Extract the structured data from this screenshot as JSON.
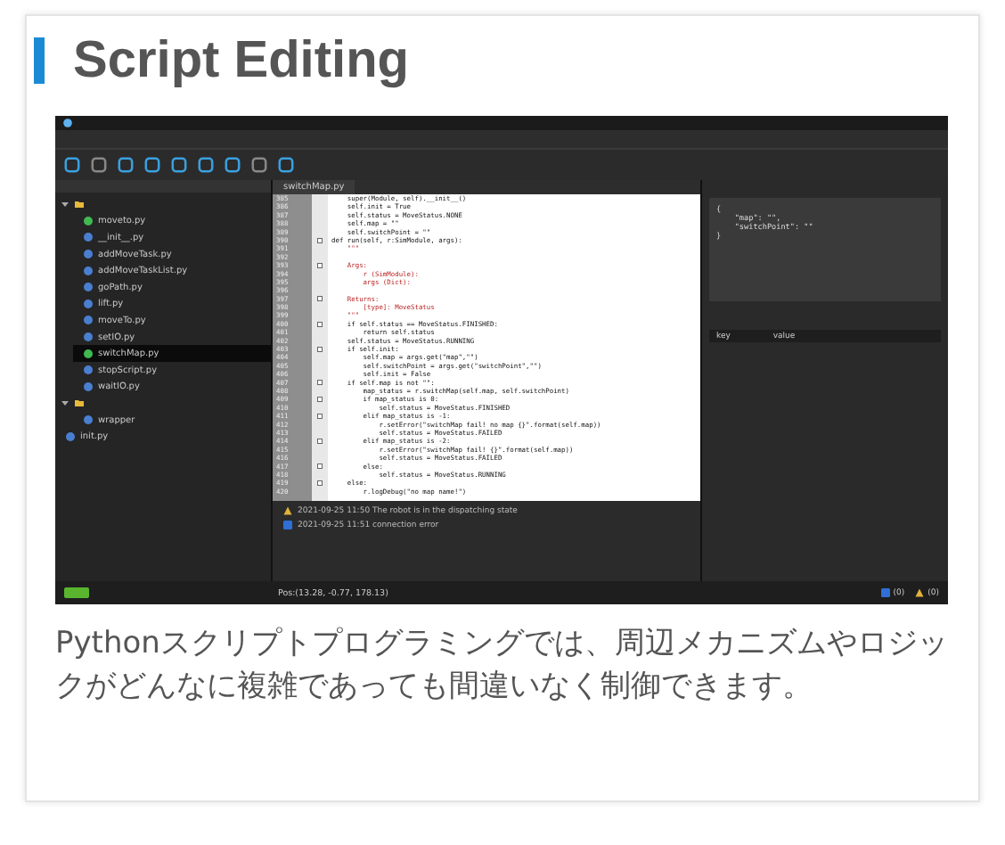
{
  "title": "Script Editing",
  "ide": {
    "sidebar": {
      "items": [
        {
          "kind": "folder",
          "children": [
            {
              "kind": "file",
              "label": "moveto.py",
              "selected": false,
              "color": "#3fb950"
            },
            {
              "kind": "file",
              "label": "__init__.py",
              "selected": false,
              "color": "#4a7fd0"
            },
            {
              "kind": "file",
              "label": "addMoveTask.py",
              "selected": false,
              "color": "#4a7fd0"
            },
            {
              "kind": "file",
              "label": "addMoveTaskList.py",
              "selected": false,
              "color": "#4a7fd0"
            },
            {
              "kind": "file",
              "label": "goPath.py",
              "selected": false,
              "color": "#4a7fd0"
            },
            {
              "kind": "file",
              "label": "lift.py",
              "selected": false,
              "color": "#4a7fd0"
            },
            {
              "kind": "file",
              "label": "moveTo.py",
              "selected": false,
              "color": "#4a7fd0"
            },
            {
              "kind": "file",
              "label": "setIO.py",
              "selected": false,
              "color": "#4a7fd0"
            },
            {
              "kind": "file",
              "label": "switchMap.py",
              "selected": true,
              "color": "#3fb950"
            },
            {
              "kind": "file",
              "label": "stopScript.py",
              "selected": false,
              "color": "#4a7fd0"
            },
            {
              "kind": "file",
              "label": "waitIO.py",
              "selected": false,
              "color": "#4a7fd0"
            }
          ]
        },
        {
          "kind": "folder",
          "children": [
            {
              "kind": "file",
              "label": "wrapper",
              "selected": false,
              "color": "#4a7fd0"
            }
          ]
        },
        {
          "kind": "file",
          "label": "init.py",
          "selected": false,
          "color": "#4a7fd0"
        }
      ]
    },
    "editor_tab": "switchMap.py",
    "code": [
      {
        "n": "385",
        "text": "    super(Module, self).__init__()",
        "kind": "code",
        "fold": false
      },
      {
        "n": "386",
        "text": "    self.init = True",
        "kind": "code",
        "fold": false
      },
      {
        "n": "387",
        "text": "    self.status = MoveStatus.NONE",
        "kind": "code",
        "fold": false
      },
      {
        "n": "388",
        "text": "    self.map = \"\"",
        "kind": "code",
        "fold": false
      },
      {
        "n": "389",
        "text": "    self.switchPoint = \"\"",
        "kind": "code",
        "fold": false
      },
      {
        "n": "390",
        "text": "def run(self, r:SimModule, args):",
        "kind": "code",
        "fold": true
      },
      {
        "n": "391",
        "text": "    \"\"\"",
        "kind": "comment",
        "fold": false
      },
      {
        "n": "392",
        "fold": false
      },
      {
        "n": "393",
        "text": "    Args:",
        "kind": "comment",
        "fold": true
      },
      {
        "n": "394",
        "text": "        r (SimModule):",
        "kind": "comment",
        "fold": false
      },
      {
        "n": "395",
        "text": "        args (Dict):",
        "kind": "comment",
        "fold": false
      },
      {
        "n": "396",
        "fold": false
      },
      {
        "n": "397",
        "text": "    Returns:",
        "kind": "comment",
        "fold": true
      },
      {
        "n": "398",
        "text": "        [type]: MoveStatus",
        "kind": "comment",
        "fold": false
      },
      {
        "n": "399",
        "text": "    \"\"\"",
        "kind": "comment",
        "fold": false
      },
      {
        "n": "400",
        "text": "    if self.status == MoveStatus.FINISHED:",
        "kind": "code",
        "fold": true
      },
      {
        "n": "401",
        "text": "        return self.status",
        "kind": "code",
        "fold": false
      },
      {
        "n": "402",
        "text": "    self.status = MoveStatus.RUNNING",
        "kind": "code",
        "fold": false
      },
      {
        "n": "403",
        "text": "    if self.init:",
        "kind": "code",
        "fold": true
      },
      {
        "n": "404",
        "text": "        self.map = args.get(\"map\",\"\")",
        "kind": "code",
        "fold": false
      },
      {
        "n": "405",
        "text": "        self.switchPoint = args.get(\"switchPoint\",\"\")",
        "kind": "code",
        "fold": false
      },
      {
        "n": "406",
        "text": "        self.init = False",
        "kind": "code",
        "fold": false
      },
      {
        "n": "407",
        "text": "    if self.map is not \"\":",
        "kind": "code",
        "fold": true
      },
      {
        "n": "408",
        "text": "        map_status = r.switchMap(self.map, self.switchPoint)",
        "kind": "code",
        "fold": false
      },
      {
        "n": "409",
        "text": "        if map_status is 0:",
        "kind": "code",
        "fold": true
      },
      {
        "n": "410",
        "text": "            self.status = MoveStatus.FINISHED",
        "kind": "code",
        "fold": false
      },
      {
        "n": "411",
        "text": "        elif map_status is -1:",
        "kind": "code",
        "fold": true
      },
      {
        "n": "412",
        "text": "            r.setError(\"switchMap fail! no map {}\".format(self.map))",
        "kind": "code",
        "fold": false
      },
      {
        "n": "413",
        "text": "            self.status = MoveStatus.FAILED",
        "kind": "code",
        "fold": false
      },
      {
        "n": "414",
        "text": "        elif map_status is -2:",
        "kind": "code",
        "fold": true
      },
      {
        "n": "415",
        "text": "            r.setError(\"switchMap fail! {}\".format(self.map))",
        "kind": "code",
        "fold": false
      },
      {
        "n": "416",
        "text": "            self.status = MoveStatus.FAILED",
        "kind": "code",
        "fold": false
      },
      {
        "n": "417",
        "text": "        else:",
        "kind": "code",
        "fold": true
      },
      {
        "n": "418",
        "text": "            self.status = MoveStatus.RUNNING",
        "kind": "code",
        "fold": false
      },
      {
        "n": "419",
        "text": "    else:",
        "kind": "code",
        "fold": true
      },
      {
        "n": "420",
        "text": "        r.logDebug(\"no map name!\")",
        "kind": "code",
        "fold": false
      }
    ],
    "args_json": [
      "{",
      "    \"map\": \"\",",
      "    \"switchPoint\": \"\"",
      "}"
    ],
    "table_columns": [
      "key",
      "value"
    ],
    "logs": [
      {
        "kind": "warning",
        "text": "2021-09-25 11:50 The robot is in the dispatching state"
      },
      {
        "kind": "info",
        "text": "2021-09-25 11:51 connection error"
      }
    ],
    "status_bar": {
      "position": "Pos:(13.28, -0.77, 178.13)",
      "counts": [
        {
          "kind": "info",
          "text": "(0)"
        },
        {
          "kind": "warning",
          "text": "(0)"
        }
      ]
    }
  },
  "caption": "Pythonスクリプトプログラミングでは、周辺メカニズムやロジックがどんなに複雑であっても間違いなく制御できます。"
}
